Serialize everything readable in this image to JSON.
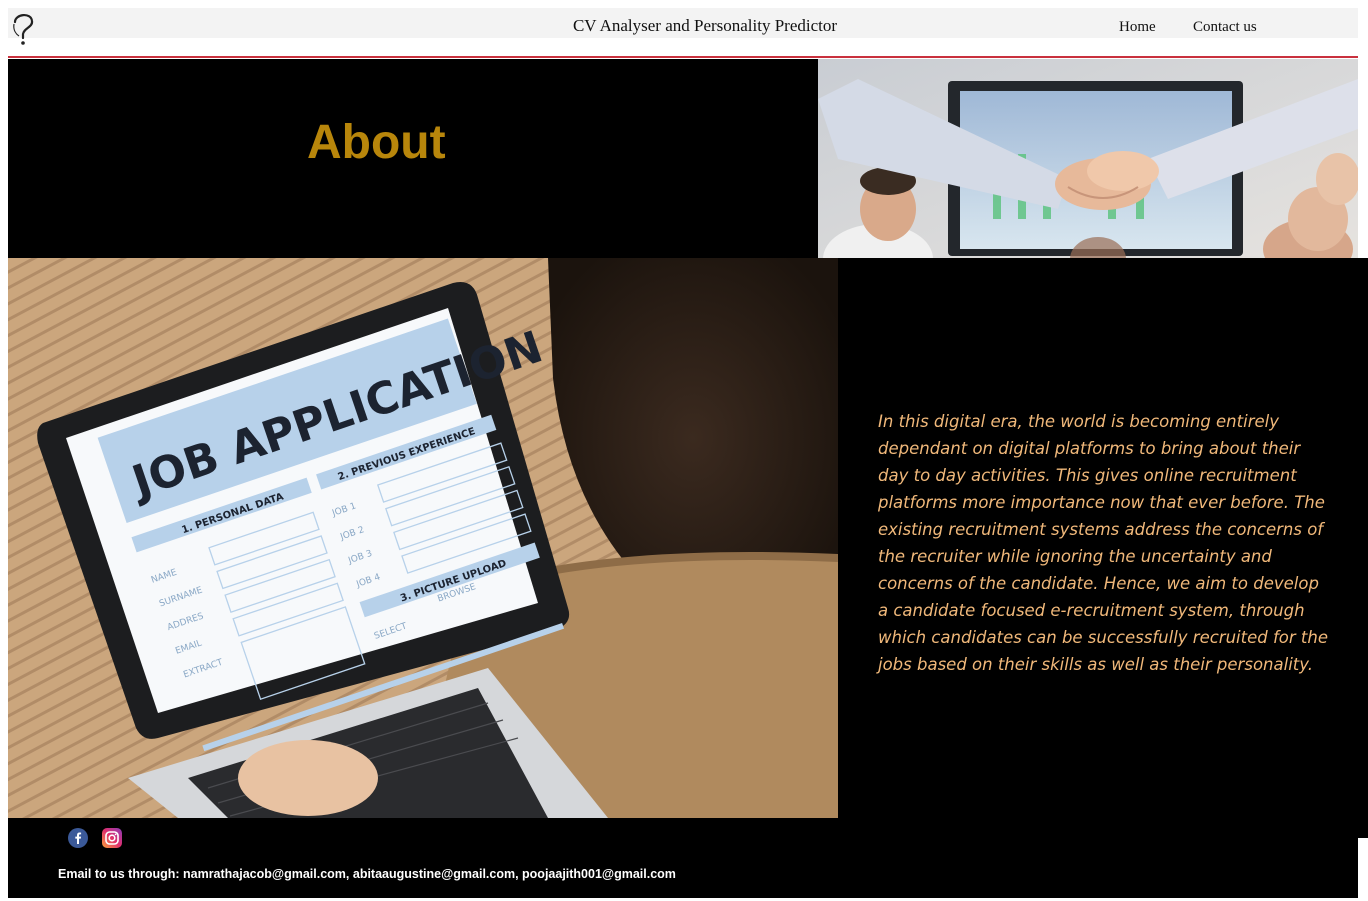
{
  "header": {
    "title": "CV Analyser and Personality Predictor",
    "logo_icon": "question-mark-head-icon",
    "nav": {
      "home": "Home",
      "contact": "Contact us"
    },
    "accent_rule_color": "#c9313e"
  },
  "about": {
    "heading": "About",
    "heading_color": "#b8860b",
    "text": "In this digital era, the world is becoming entirely dependant on digital platforms to bring about their day to day activities. This gives online recruitment platforms more importance now that ever before. The existing recruitment systems address the concerns of the recruiter while ignoring the uncertainty and concerns of the candidate. Hence, we aim to develop a candidate focused e-recruitment system, through which candidates can be successfully recruited for the jobs based on their skills as well as their personality.",
    "text_color": "#f0b87a"
  },
  "images": {
    "handshake_icon": "handshake-photo",
    "laptop_icon": "job-application-laptop-photo",
    "laptop_screen": {
      "title": "JOB APPLICATION",
      "personal_data": "1. PERSONAL DATA",
      "previous_experience": "2. PREVIOUS EXPERIENCE",
      "picture_upload": "3. PICTURE UPLOAD",
      "fields": [
        "NAME",
        "SURNAME",
        "ADDRES",
        "EMAIL",
        "EXTRACT"
      ],
      "jobs": [
        "JOB 1",
        "JOB 2",
        "JOB 3",
        "JOB 4"
      ],
      "select": "SELECT",
      "browse": "BROWSE"
    }
  },
  "footer": {
    "social": [
      "facebook-icon",
      "instagram-icon"
    ],
    "email_text": "Email to us through: namrathajacob@gmail.com, abitaaugustine@gmail.com, poojaajith001@gmail.com"
  }
}
